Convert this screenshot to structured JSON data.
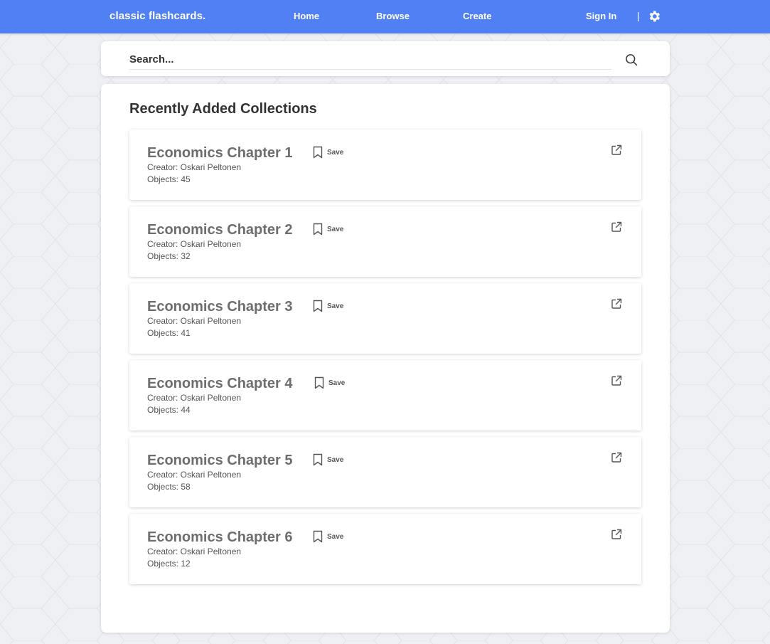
{
  "app": {
    "brand": "classic flashcards."
  },
  "nav": {
    "home": "Home",
    "browse": "Browse",
    "create": "Create",
    "sign_in": "Sign In",
    "separator": "|"
  },
  "search": {
    "placeholder": "Search..."
  },
  "section": {
    "title": "Recently Added Collections"
  },
  "collections": [
    {
      "title": "Economics Chapter 1",
      "save_label": "Save",
      "creator": "Creator: Oskari Peltonen",
      "objects": "Objects: 45"
    },
    {
      "title": "Economics Chapter 2",
      "save_label": "Save",
      "creator": "Creator: Oskari Peltonen",
      "objects": "Objects: 32"
    },
    {
      "title": "Economics Chapter 3",
      "save_label": "Save",
      "creator": "Creator: Oskari Peltonen",
      "objects": "Objects: 41"
    },
    {
      "title": "Economics Chapter 4",
      "save_label": "Save",
      "creator": "Creator: Oskari Peltonen",
      "objects": "Objects: 44"
    },
    {
      "title": "Economics Chapter 5",
      "save_label": "Save",
      "creator": "Creator: Oskari Peltonen",
      "objects": "Objects: 58"
    },
    {
      "title": "Economics Chapter 6",
      "save_label": "Save",
      "creator": "Creator: Oskari Peltonen",
      "objects": "Objects: 12"
    }
  ],
  "icons": {
    "settings": "gear-icon",
    "search": "search-icon",
    "save": "bookmark-icon",
    "open": "external-link-icon"
  },
  "colors": {
    "navbar": "#5080f4",
    "background": "#eef0f4",
    "card": "#ffffff",
    "title_text": "#333333",
    "collection_title": "#6d6d6d"
  }
}
